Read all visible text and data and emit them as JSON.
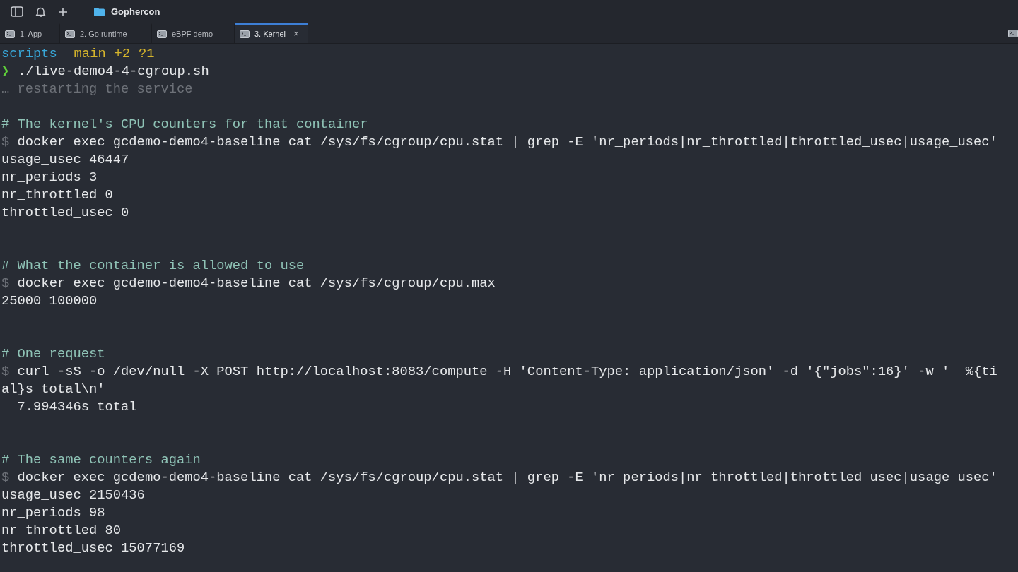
{
  "window": {
    "title": "Gophercon"
  },
  "tabs": [
    {
      "label": "1. App",
      "selected": false
    },
    {
      "label": "2. Go runtime",
      "selected": false
    },
    {
      "label": "eBPF demo",
      "selected": false
    },
    {
      "label": "3. Kernel",
      "selected": true,
      "close": "×"
    }
  ],
  "terminal": {
    "lines": [
      {
        "kind": "prompt",
        "directory": "scripts",
        "branch": "main",
        "changes": "+2",
        "untracked": "?1"
      },
      {
        "kind": "run",
        "symbol": "❯",
        "text": "./live-demo4-4-cgroup.sh"
      },
      {
        "kind": "dim",
        "text": "… restarting the service"
      },
      {
        "kind": "blank"
      },
      {
        "kind": "comment",
        "text": "# The kernel's CPU counters for that container"
      },
      {
        "kind": "command",
        "symbol": "$",
        "text": "docker exec gcdemo-demo4-baseline cat /sys/fs/cgroup/cpu.stat | grep -E 'nr_periods|nr_throttled|throttled_usec|usage_usec'"
      },
      {
        "kind": "output",
        "text": "usage_usec 46447"
      },
      {
        "kind": "output",
        "text": "nr_periods 3"
      },
      {
        "kind": "output",
        "text": "nr_throttled 0"
      },
      {
        "kind": "output",
        "text": "throttled_usec 0"
      },
      {
        "kind": "blank"
      },
      {
        "kind": "blank"
      },
      {
        "kind": "comment",
        "text": "# What the container is allowed to use"
      },
      {
        "kind": "command",
        "symbol": "$",
        "text": "docker exec gcdemo-demo4-baseline cat /sys/fs/cgroup/cpu.max"
      },
      {
        "kind": "output",
        "text": "25000 100000"
      },
      {
        "kind": "blank"
      },
      {
        "kind": "blank"
      },
      {
        "kind": "comment",
        "text": "# One request"
      },
      {
        "kind": "command",
        "symbol": "$",
        "text": "curl -sS -o /dev/null -X POST http://localhost:8083/compute -H 'Content-Type: application/json' -d '{\"jobs\":16}' -w '  %{ti"
      },
      {
        "kind": "output",
        "text": "al}s total\\n'"
      },
      {
        "kind": "output",
        "text": "  7.994346s total"
      },
      {
        "kind": "blank"
      },
      {
        "kind": "blank"
      },
      {
        "kind": "comment",
        "text": "# The same counters again"
      },
      {
        "kind": "command",
        "symbol": "$",
        "text": "docker exec gcdemo-demo4-baseline cat /sys/fs/cgroup/cpu.stat | grep -E 'nr_periods|nr_throttled|throttled_usec|usage_usec'"
      },
      {
        "kind": "output",
        "text": "usage_usec 2150436"
      },
      {
        "kind": "output",
        "text": "nr_periods 98"
      },
      {
        "kind": "output",
        "text": "nr_throttled 80"
      },
      {
        "kind": "output",
        "text": "throttled_usec 15077169"
      }
    ]
  }
}
